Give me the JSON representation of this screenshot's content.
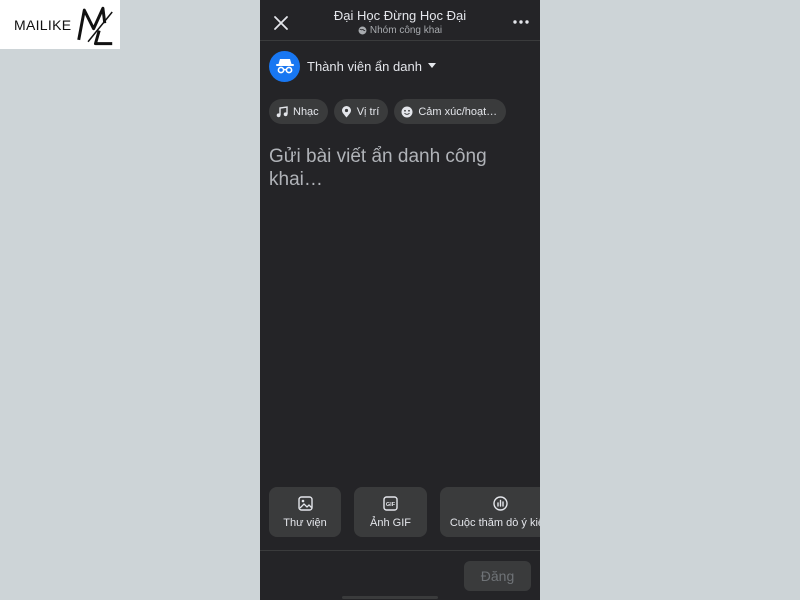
{
  "watermark": {
    "text": "MAILIKE",
    "mark": "ML"
  },
  "header": {
    "title": "Đại Học Đừng Học Đại",
    "privacy": "Nhóm công khai"
  },
  "author": {
    "name": "Thành viên ẩn danh",
    "avatar_icon": "incognito-icon"
  },
  "chips": [
    {
      "label": "Nhạc",
      "icon": "music-note-icon"
    },
    {
      "label": "Vị trí",
      "icon": "location-pin-icon"
    },
    {
      "label": "Cảm xúc/hoạt…",
      "icon": "smiley-icon"
    }
  ],
  "composer": {
    "placeholder": "Gửi bài viết ẩn danh công khai…"
  },
  "actions": [
    {
      "label": "Thư viện",
      "icon": "photo-icon"
    },
    {
      "label": "Ảnh GIF",
      "icon": "gif-icon"
    },
    {
      "label": "Cuộc thăm dò ý kiến",
      "icon": "poll-icon"
    }
  ],
  "footer": {
    "post_label": "Đăng"
  },
  "colors": {
    "background": "#cdd4d7",
    "screen": "#242427",
    "chip": "#3a3b3c",
    "accent": "#1877f2",
    "text": "#e4e6eb",
    "muted": "#b0b3b8"
  }
}
